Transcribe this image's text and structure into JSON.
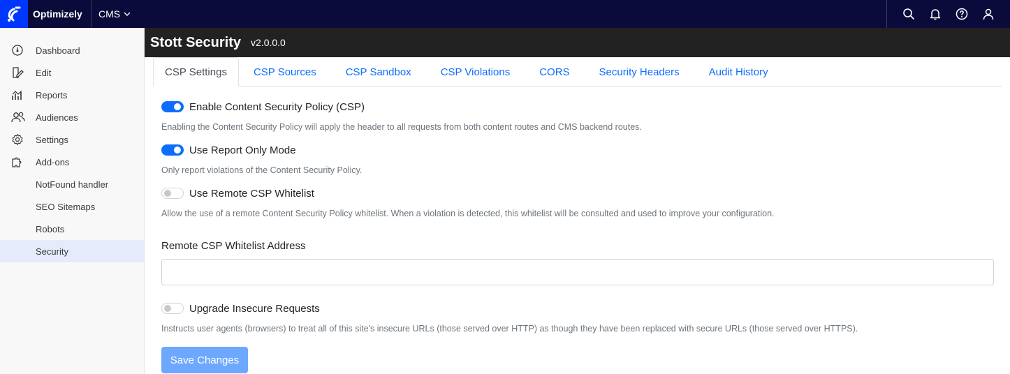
{
  "topbar": {
    "brand": "Optimizely",
    "app": "CMS",
    "icons": [
      "search-icon",
      "bell-icon",
      "help-icon",
      "user-icon"
    ]
  },
  "sidebar": {
    "items": [
      {
        "label": "Dashboard",
        "icon": "dashboard-icon"
      },
      {
        "label": "Edit",
        "icon": "edit-icon"
      },
      {
        "label": "Reports",
        "icon": "reports-icon"
      },
      {
        "label": "Audiences",
        "icon": "audiences-icon"
      },
      {
        "label": "Settings",
        "icon": "gear-icon"
      },
      {
        "label": "Add-ons",
        "icon": "puzzle-icon"
      }
    ],
    "subitems": [
      {
        "label": "NotFound handler"
      },
      {
        "label": "SEO Sitemaps"
      },
      {
        "label": "Robots"
      },
      {
        "label": "Security",
        "active": true
      }
    ]
  },
  "header": {
    "title": "Stott Security",
    "version": "v2.0.0.0"
  },
  "tabs": [
    {
      "label": "CSP Settings",
      "active": true
    },
    {
      "label": "CSP Sources"
    },
    {
      "label": "CSP Sandbox"
    },
    {
      "label": "CSP Violations"
    },
    {
      "label": "CORS"
    },
    {
      "label": "Security Headers"
    },
    {
      "label": "Audit History"
    }
  ],
  "settings": {
    "enable_csp": {
      "label": "Enable Content Security Policy (CSP)",
      "help": "Enabling the Content Security Policy will apply the header to all requests from both content routes and CMS backend routes.",
      "checked": true
    },
    "report_only": {
      "label": "Use Report Only Mode",
      "help": "Only report violations of the Content Security Policy.",
      "checked": true
    },
    "remote_whitelist": {
      "label": "Use Remote CSP Whitelist",
      "help": "Allow the use of a remote Content Security Policy whitelist. When a violation is detected, this whitelist will be consulted and used to improve your configuration.",
      "checked": false
    },
    "whitelist_address": {
      "label": "Remote CSP Whitelist Address",
      "value": "",
      "placeholder": ""
    },
    "upgrade_insecure": {
      "label": "Upgrade Insecure Requests",
      "help": "Instructs user agents (browsers) to treat all of this site's insecure URLs (those served over HTTP) as though they have been replaced with secure URLs (those served over HTTPS).",
      "checked": false
    },
    "save_label": "Save Changes"
  },
  "colors": {
    "topbar": "#0b0b3b",
    "brand": "#0037ff",
    "accent": "#0d6efd",
    "save_button": "#6ea8fe"
  }
}
